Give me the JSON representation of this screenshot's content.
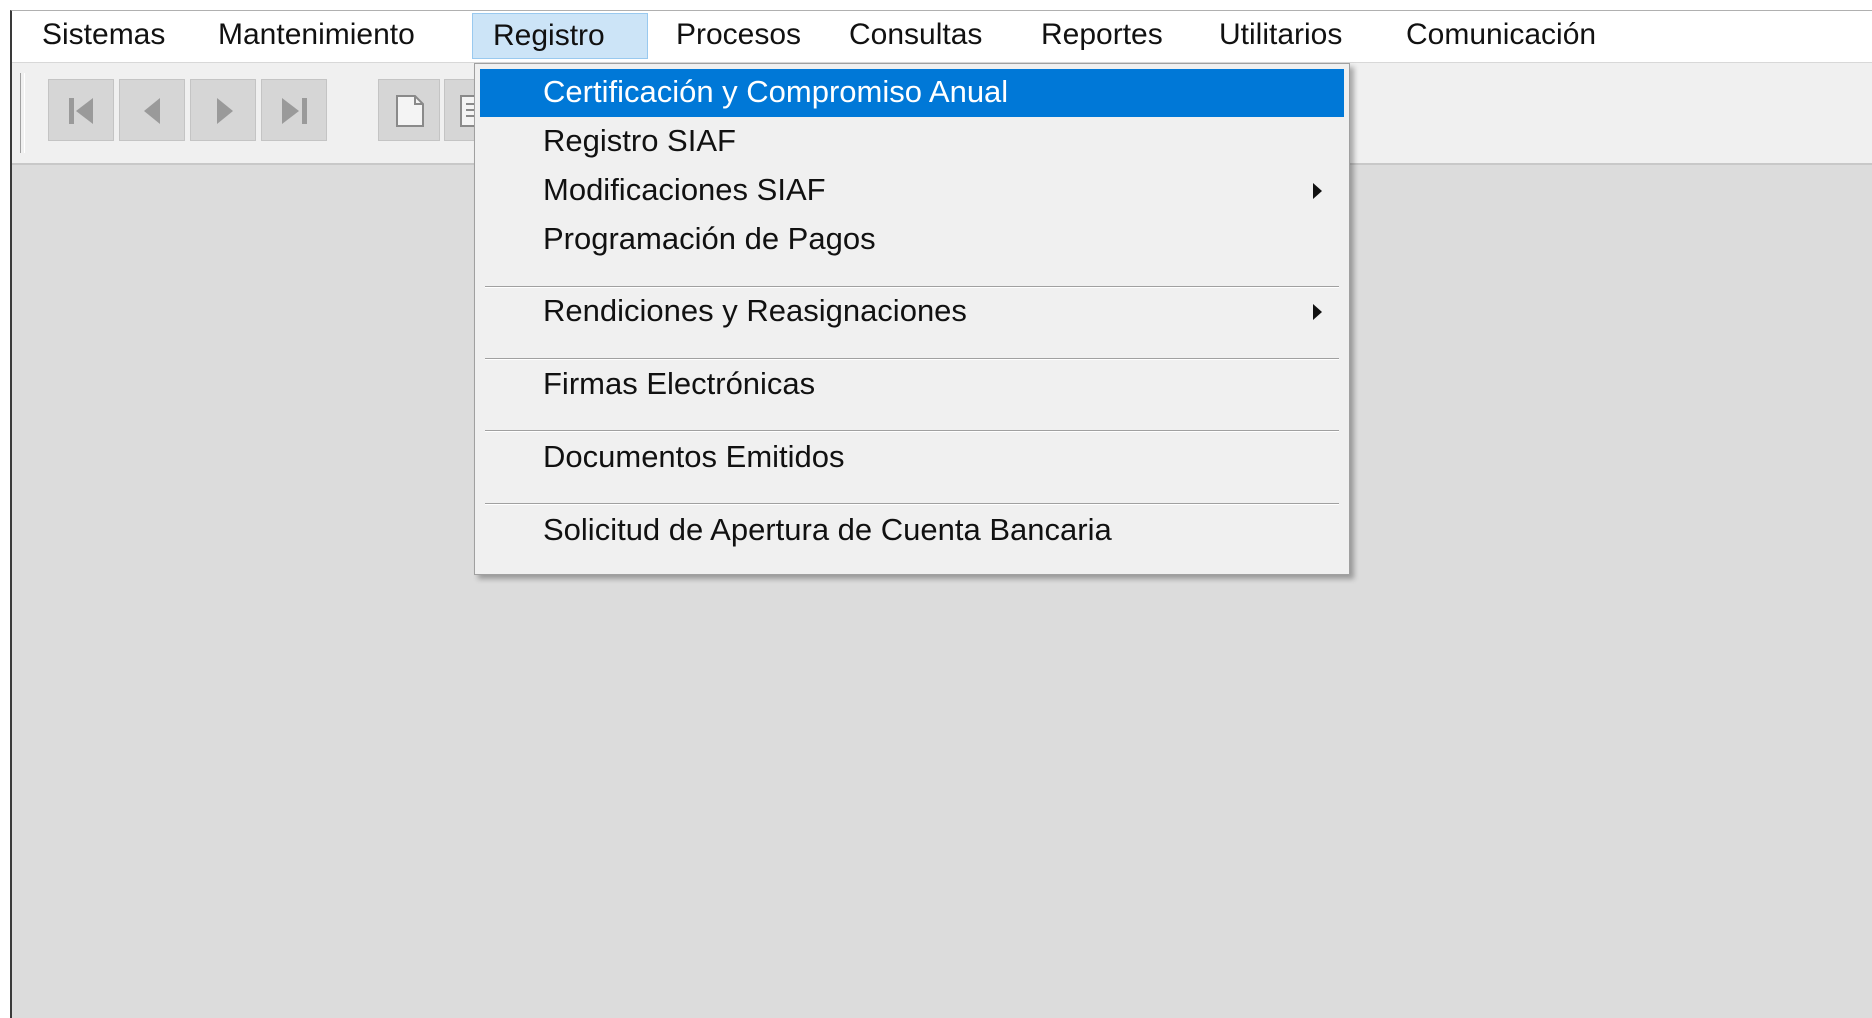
{
  "menubar": {
    "items": [
      {
        "label": "Sistemas"
      },
      {
        "label": "Mantenimiento"
      },
      {
        "label": "Registro",
        "active": true
      },
      {
        "label": "Procesos"
      },
      {
        "label": "Consultas"
      },
      {
        "label": "Reportes"
      },
      {
        "label": "Utilitarios"
      },
      {
        "label": "Comunicación"
      }
    ]
  },
  "toolbar": {
    "buttons": [
      {
        "icon": "first-record-icon"
      },
      {
        "icon": "previous-record-icon"
      },
      {
        "icon": "next-record-icon"
      },
      {
        "icon": "last-record-icon"
      },
      {
        "icon": "new-document-icon"
      },
      {
        "icon": "document-icon"
      }
    ]
  },
  "dropdown": {
    "parent": "Registro",
    "items": [
      {
        "label": "Certificación y Compromiso Anual",
        "highlighted": true
      },
      {
        "label": "Registro SIAF"
      },
      {
        "label": "Modificaciones SIAF",
        "submenu": true
      },
      {
        "label": "Programación de Pagos"
      },
      {
        "label": "Rendiciones y Reasignaciones",
        "submenu": true
      },
      {
        "label": "Firmas Electrónicas"
      },
      {
        "label": "Documentos Emitidos"
      },
      {
        "label": "Solicitud de Apertura de Cuenta Bancaria"
      }
    ]
  },
  "colors": {
    "highlight": "#0078d7",
    "active_menu": "#cce4f7",
    "workspace": "#dcdcdc",
    "menu_background": "#f0f0f0"
  }
}
